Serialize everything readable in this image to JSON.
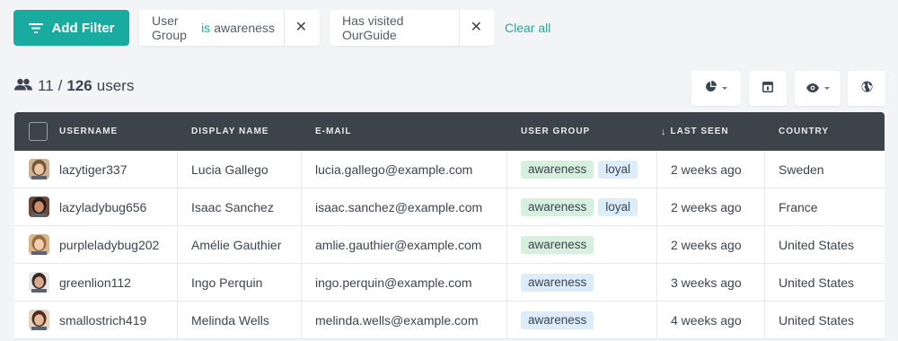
{
  "filters": {
    "add_label": "Add Filter",
    "chips": [
      {
        "field": "User Group",
        "operator": "is",
        "value": "awareness"
      },
      {
        "field": "Has visited OurGuide",
        "operator": "",
        "value": ""
      }
    ],
    "close_glyph": "✕",
    "clear_label": "Clear all"
  },
  "count": {
    "shown": "11",
    "separator": "/",
    "total": "126",
    "unit": "users"
  },
  "toolbar": {
    "buttons": [
      {
        "icon": "pie-chart-icon",
        "has_dropdown": true
      },
      {
        "icon": "layout-icon",
        "has_dropdown": false
      },
      {
        "icon": "eye-icon",
        "has_dropdown": true
      },
      {
        "icon": "globe-icon",
        "has_dropdown": false
      }
    ]
  },
  "table": {
    "columns": [
      "USERNAME",
      "DISPLAY NAME",
      "E-MAIL",
      "USER GROUP",
      "LAST SEEN",
      "COUNTRY"
    ],
    "sort_glyph": "↓",
    "rows": [
      {
        "username": "lazytiger337",
        "display_name": "Lucia Gallego",
        "email": "lucia.gallego@example.com",
        "groups": [
          {
            "label": "awareness",
            "color": "green"
          },
          {
            "label": "loyal",
            "color": "blue"
          }
        ],
        "last_seen": "2 weeks ago",
        "country": "Sweden",
        "avatar": {
          "bg": "#c9b49a",
          "hair": "#7a5436",
          "skin": "#e8c4a6"
        }
      },
      {
        "username": "lazyladybug656",
        "display_name": "Isaac Sanchez",
        "email": "isaac.sanchez@example.com",
        "groups": [
          {
            "label": "awareness",
            "color": "green"
          },
          {
            "label": "loyal",
            "color": "blue"
          }
        ],
        "last_seen": "2 weeks ago",
        "country": "France",
        "avatar": {
          "bg": "#6b4a3a",
          "hair": "#2a1a14",
          "skin": "#c98e6e"
        }
      },
      {
        "username": "purpleladybug202",
        "display_name": "Amélie Gauthier",
        "email": "amlie.gauthier@example.com",
        "groups": [
          {
            "label": "awareness",
            "color": "green"
          }
        ],
        "last_seen": "2 weeks ago",
        "country": "United States",
        "avatar": {
          "bg": "#d8b68c",
          "hair": "#9a6a3c",
          "skin": "#f0cfb0"
        }
      },
      {
        "username": "greenlion112",
        "display_name": "Ingo Perquin",
        "email": "ingo.perquin@example.com",
        "groups": [
          {
            "label": "awareness",
            "color": "blue"
          }
        ],
        "last_seen": "3 weeks ago",
        "country": "United States",
        "avatar": {
          "bg": "#e8e8e8",
          "hair": "#3a2a24",
          "skin": "#d9a88a"
        }
      },
      {
        "username": "smallostrich419",
        "display_name": "Melinda Wells",
        "email": "melinda.wells@example.com",
        "groups": [
          {
            "label": "awareness",
            "color": "blue"
          }
        ],
        "last_seen": "4 weeks ago",
        "country": "United States",
        "avatar": {
          "bg": "#e5d3c1",
          "hair": "#4a2e22",
          "skin": "#e6b999"
        }
      }
    ]
  },
  "colors": {
    "accent": "#1aaba0",
    "header_bg": "#3d434b",
    "tag_green": "#d7f0de",
    "tag_blue": "#dcecf9"
  }
}
